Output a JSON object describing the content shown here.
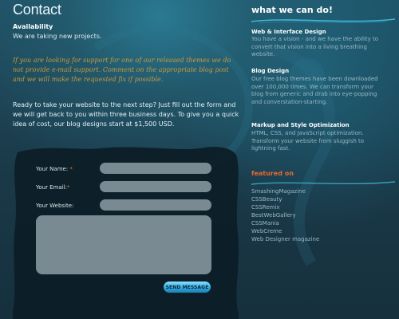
{
  "page": {
    "title": "Contact"
  },
  "availability": {
    "heading": "Availability",
    "text": "We are taking new projects."
  },
  "support_note": "If you are looking for support for one of our released themes we do not provide e-mail support. Comment on the appropriate blog post and we will make the requested fix if possible.",
  "intro": "Ready to take your website to the next step? Just fill out the form and we will get back to you within three business days. To give you a quick idea of cost, our blog designs start at $1,500 USD.",
  "form": {
    "name_label": "Your Name:",
    "email_label": "Your Email:",
    "website_label": "Your Website:",
    "required_mark": "*",
    "name_value": "",
    "email_value": "",
    "website_value": "",
    "message_value": "",
    "submit_label": "SEND MESSAGE"
  },
  "sidebar": {
    "services_heading": "what we can do!",
    "services": [
      {
        "title": "Web & Interface Design",
        "text": "You have a vision - and we have the ability to convert that vision into a living breathing website."
      },
      {
        "title": "Blog Design",
        "text": "Our free blog themes have been downloaded over 100,000 times. We can transform your blog from generic and drab into eye-popping and converstation-starting."
      },
      {
        "title": "Markup and Style Optimization",
        "text": "HTML, CSS, and JavaScript optimization. Transform your website from sluggish to lightning fast."
      }
    ],
    "featured_heading": "featured on",
    "featured": [
      "SmashingMagazine",
      "CSSBeauty",
      "CSSRemix",
      "BestWebGallery",
      "CSSMania",
      "WebCreme",
      "Web Designer magazine"
    ]
  },
  "colors": {
    "accent_orange": "#e86a2e",
    "note_gold": "#c89a3c",
    "button_blue": "#2ea9e0",
    "background": "#1b3a4a"
  }
}
